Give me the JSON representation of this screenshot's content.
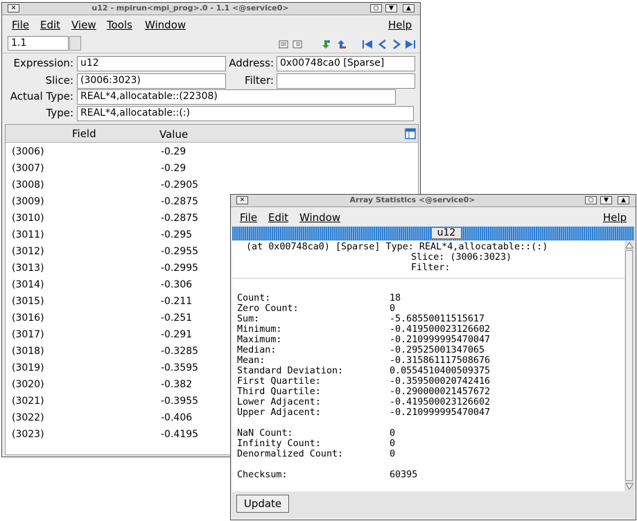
{
  "main_window": {
    "title": "u12 - mpirun<mpi_prog>.0 - 1.1 <@service0>",
    "menus": [
      "File",
      "Edit",
      "View",
      "Tools",
      "Window"
    ],
    "help": "Help",
    "context_value": "1.1",
    "expression_label": "Expression:",
    "expression_value": "u12",
    "address_label": "Address:",
    "address_value": "0x00748ca0  [Sparse]",
    "slice_label": "Slice:",
    "slice_value": "(3006:3023)",
    "filter_label": "Filter:",
    "filter_value": "",
    "actual_type_label": "Actual Type:",
    "actual_type_value": "REAL*4,allocatable::(22308)",
    "type_label": "Type:",
    "type_value": "REAL*4,allocatable::(:)",
    "col_field": "Field",
    "col_value": "Value",
    "rows": [
      {
        "field": "(3006)",
        "value": "-0.29"
      },
      {
        "field": "(3007)",
        "value": "-0.29"
      },
      {
        "field": "(3008)",
        "value": "-0.2905"
      },
      {
        "field": "(3009)",
        "value": "-0.2875"
      },
      {
        "field": "(3010)",
        "value": "-0.2875"
      },
      {
        "field": "(3011)",
        "value": "-0.295"
      },
      {
        "field": "(3012)",
        "value": "-0.2955"
      },
      {
        "field": "(3013)",
        "value": "-0.2995"
      },
      {
        "field": "(3014)",
        "value": "-0.306"
      },
      {
        "field": "(3015)",
        "value": "-0.211"
      },
      {
        "field": "(3016)",
        "value": "-0.251"
      },
      {
        "field": "(3017)",
        "value": "-0.291"
      },
      {
        "field": "(3018)",
        "value": "-0.3285"
      },
      {
        "field": "(3019)",
        "value": "-0.3595"
      },
      {
        "field": "(3020)",
        "value": "-0.382"
      },
      {
        "field": "(3021)",
        "value": "-0.3955"
      },
      {
        "field": "(3022)",
        "value": "-0.406"
      },
      {
        "field": "(3023)",
        "value": "-0.4195"
      }
    ]
  },
  "stats_window": {
    "title": "Array Statistics <@service0>",
    "menus": [
      "File",
      "Edit",
      "Window"
    ],
    "help": "Help",
    "tab_label": "u12",
    "header_line1": "(at 0x00748ca0) [Sparse] Type: REAL*4,allocatable::(:)",
    "header_line2": "Slice: (3006:3023)",
    "header_line3": "Filter:",
    "stats": [
      {
        "label": "Count:",
        "value": "18"
      },
      {
        "label": "Zero Count:",
        "value": "0"
      },
      {
        "label": "Sum:",
        "value": "-5.68550011515617"
      },
      {
        "label": "Minimum:",
        "value": "-0.419500023126602"
      },
      {
        "label": "Maximum:",
        "value": "-0.210999995470047"
      },
      {
        "label": "Median:",
        "value": "-0.29525001347065"
      },
      {
        "label": "Mean:",
        "value": "-0.315861117508676"
      },
      {
        "label": "Standard Deviation:",
        "value": "0.0554510400509375"
      },
      {
        "label": "First Quartile:",
        "value": "-0.359500020742416"
      },
      {
        "label": "Third Quartile:",
        "value": "-0.290000021457672"
      },
      {
        "label": "Lower Adjacent:",
        "value": "-0.419500023126602"
      },
      {
        "label": "Upper Adjacent:",
        "value": "-0.210999995470047"
      }
    ],
    "stats2": [
      {
        "label": "NaN Count:",
        "value": "0"
      },
      {
        "label": "Infinity Count:",
        "value": "0"
      },
      {
        "label": "Denormalized Count:",
        "value": "0"
      }
    ],
    "checksum_label": "Checksum:",
    "checksum_value": "60395",
    "update_label": "Update"
  },
  "colors": {
    "tab_stripe": "#2f7fd0",
    "window_bg": "#ececec"
  }
}
